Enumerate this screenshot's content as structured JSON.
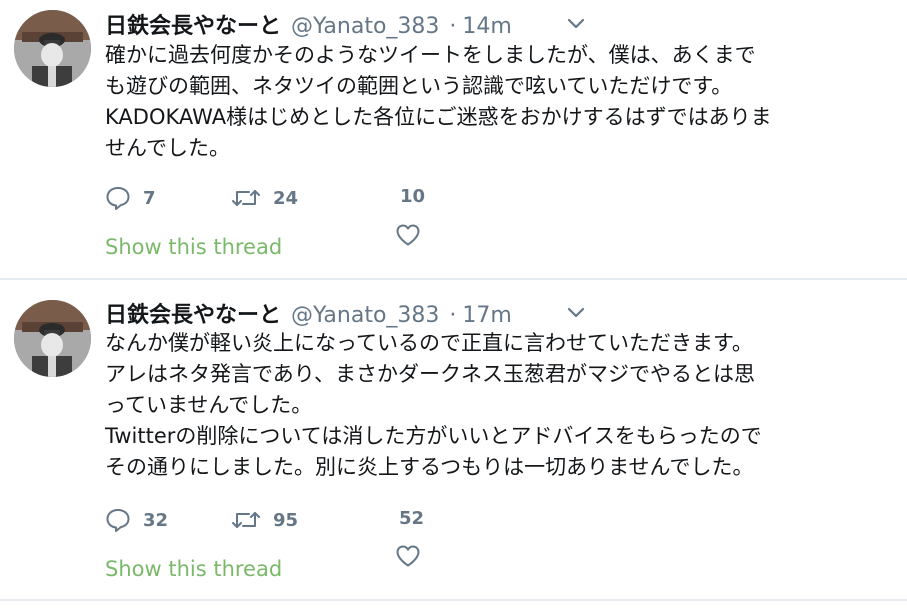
{
  "tweets": [
    {
      "author_name": "日鉄会長やなーと",
      "handle": "@Yanato_383",
      "separator": "·",
      "time": "14m",
      "lines": [
        "確かに過去何度かそのようなツイートをしましたが、僕は、あくまで",
        "も遊びの範囲、ネタツイの範囲という認識で呟いていただけです。",
        "KADOKAWA様はじめとした各位にご迷惑をおかけするはずではありま",
        "せんでした。"
      ],
      "reply_count": "7",
      "retweet_count": "24",
      "like_count": "10",
      "show_thread_label": "Show this thread"
    },
    {
      "author_name": "日鉄会長やなーと",
      "handle": "@Yanato_383",
      "separator": "·",
      "time": "17m",
      "lines": [
        "なんか僕が軽い炎上になっているので正直に言わせていただきます。",
        "アレはネタ発言であり、まさかダークネス玉葱君がマジでやるとは思",
        "っていませんでした。",
        "Twitterの削除については消した方がいいとアドバイスをもらったので",
        "その通りにしました。別に炎上するつもりは一切ありませんでした。"
      ],
      "reply_count": "32",
      "retweet_count": "95",
      "like_count": "52",
      "show_thread_label": "Show this thread"
    }
  ],
  "colors": {
    "text": "#14171a",
    "secondary": "#657786",
    "link": "#7ab96a",
    "divider": "#e6ecf0"
  },
  "icons": {
    "reply": "reply-icon",
    "retweet": "retweet-icon",
    "like": "heart-icon",
    "more": "chevron-down-icon"
  }
}
